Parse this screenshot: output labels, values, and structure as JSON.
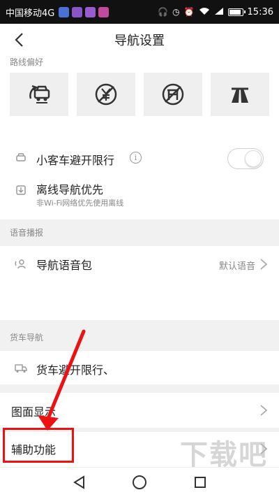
{
  "status_bar": {
    "carrier": "中国移动4G",
    "time": "15:36",
    "app_icon_colors": [
      "#4a6fd6",
      "#8a55c8",
      "#9b5bd0",
      "#c24a9c"
    ]
  },
  "header": {
    "back_icon": "chevron-left-icon",
    "title": "导航设置"
  },
  "route_preference": {
    "label": "路线偏好",
    "options": [
      {
        "icon": "avoid-congestion-icon"
      },
      {
        "icon": "avoid-toll-icon"
      },
      {
        "icon": "no-highway-icon"
      },
      {
        "icon": "highway-priority-icon"
      }
    ]
  },
  "car_restriction": {
    "label": "小客车避开限行",
    "enabled": false
  },
  "offline_nav": {
    "label": "离线导航优先",
    "sub": "非Wi-Fi网络优先使用离线"
  },
  "voice": {
    "section_label": "语音播报",
    "item_label": "导航语音包",
    "value": "默认语音"
  },
  "truck": {
    "section_label": "货车导航",
    "item_label": "货车避开限行、"
  },
  "map_display": {
    "label": "图面显示"
  },
  "assist": {
    "label": "辅助功能"
  },
  "watermark": "下载吧",
  "colors": {
    "accent_red": "#e11111",
    "section_gray": "#f1f1f1"
  }
}
